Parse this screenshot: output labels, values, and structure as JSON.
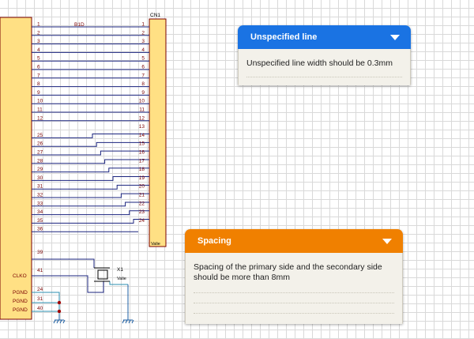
{
  "schematic": {
    "connector_ref": "CN1",
    "net_label": "B1D",
    "connector_value": "Valie",
    "crystal_ref": "X1",
    "crystal_value": "Valie",
    "left_labels": [
      "CLKO",
      "PGND",
      "PGND",
      "PGND"
    ],
    "left_pins_top": [
      "1",
      "2",
      "3",
      "4",
      "5",
      "6",
      "7",
      "8",
      "9",
      "10",
      "11",
      "12"
    ],
    "right_pins_top": [
      "1",
      "2",
      "3",
      "4",
      "5",
      "6",
      "7",
      "8",
      "9",
      "10",
      "11",
      "12"
    ],
    "left_pins_cross": [
      "25",
      "26",
      "27",
      "28",
      "29",
      "30",
      "31",
      "32",
      "33",
      "34",
      "35",
      "36"
    ],
    "right_pins_cross": [
      "13",
      "14",
      "15",
      "16",
      "17",
      "18",
      "19",
      "20",
      "21",
      "22",
      "23",
      "24"
    ],
    "left_pins_bottom": [
      "39",
      "41",
      "24",
      "31",
      "40"
    ]
  },
  "panels": {
    "line": {
      "title": "Unspecified line",
      "body": "Unspecified line width should be 0.3mm",
      "color": "#1a73e3"
    },
    "spacing": {
      "title": "Spacing",
      "body": "Spacing of the primary side and the secondary side should be more than 8mm",
      "color": "#f08000"
    }
  }
}
